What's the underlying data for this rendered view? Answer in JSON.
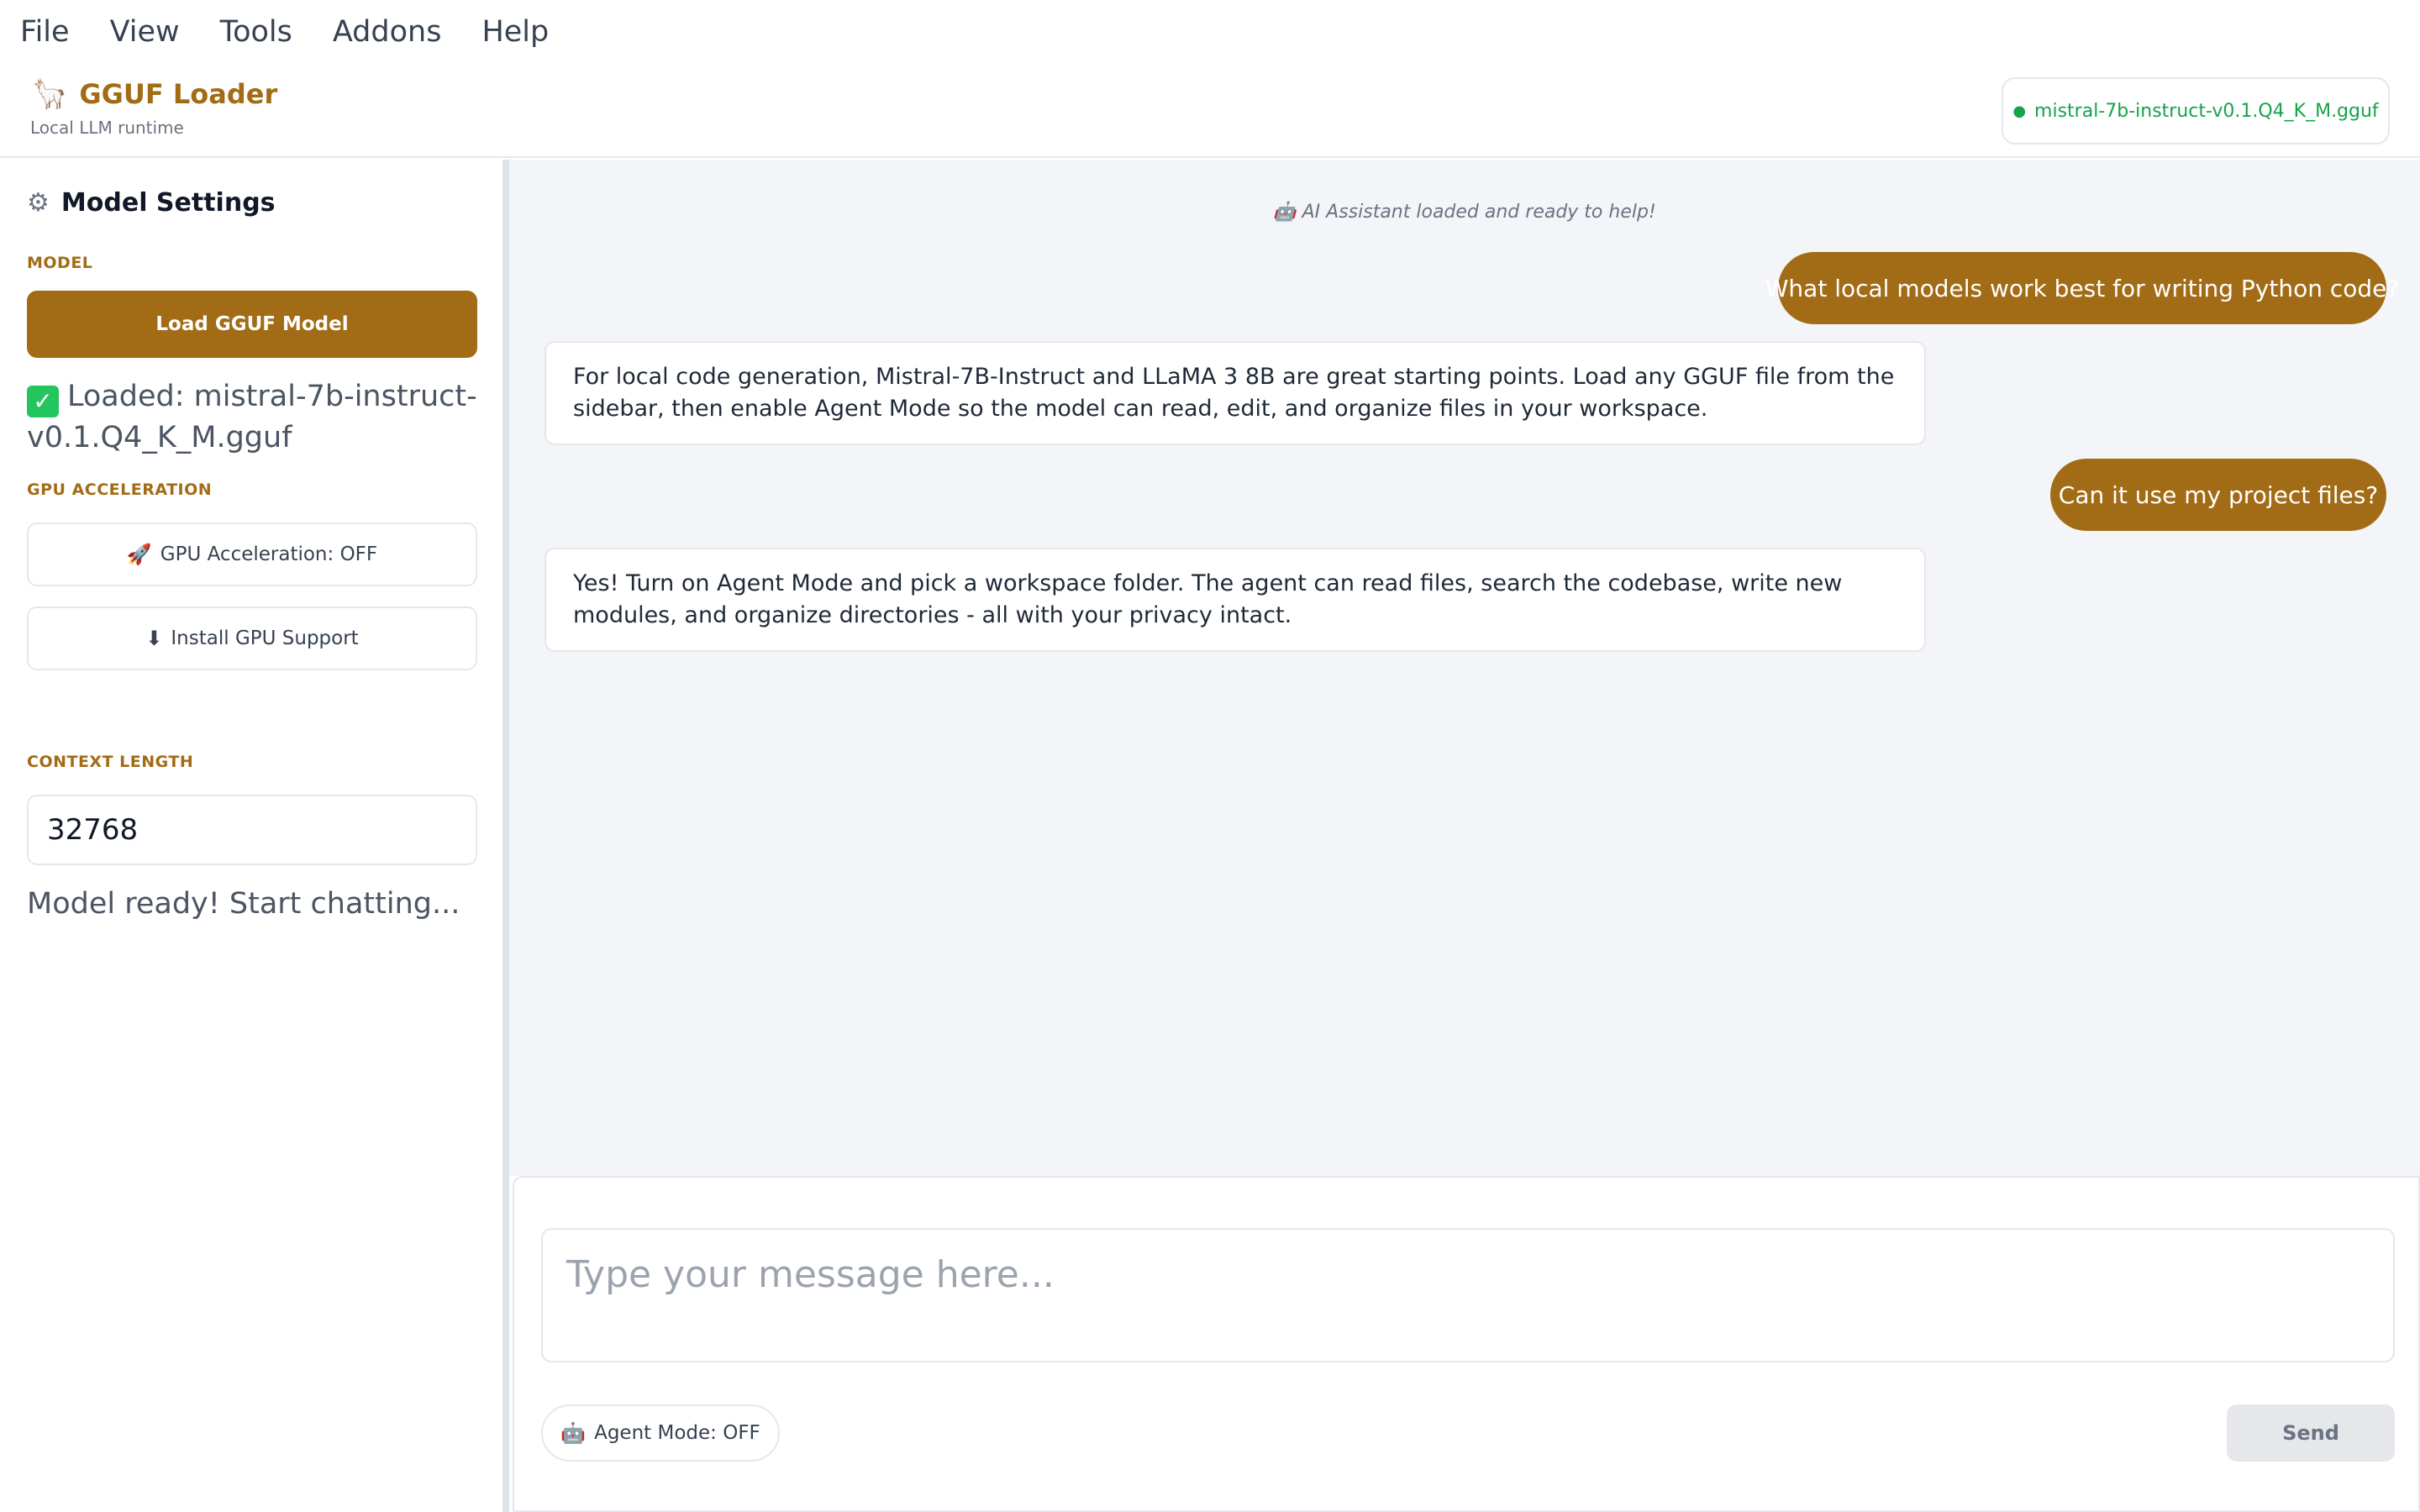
{
  "menubar": {
    "items": [
      "File",
      "View",
      "Tools",
      "Addons",
      "Help"
    ]
  },
  "header": {
    "app_icon": "llama-icon",
    "title": "GGUF Loader",
    "subtitle": "Local LLM runtime",
    "model_status": "mistral-7b-instruct-v0.1.Q4_K_M.gguf",
    "model_status_color": "#16a34a"
  },
  "sidebar": {
    "title": "Model Settings",
    "title_icon": "gear-icon",
    "model_section": "MODEL",
    "load_button": "Load GGUF Model",
    "loaded_text": "Loaded: mistral-7b-instruct-v0.1.Q4_K_M.gguf",
    "gpu_section": "GPU ACCELERATION",
    "gpu_toggle_icon": "rocket-icon",
    "gpu_toggle": "GPU Acceleration: OFF",
    "install_gpu_icon": "download-arrow-icon",
    "install_gpu": "Install GPU Support",
    "context_section": "CONTEXT LENGTH",
    "context_value": "32768",
    "status": "Model ready! Start chatting..."
  },
  "chat": {
    "system_message": "AI Assistant loaded and ready to help!",
    "system_icon": "robot-icon",
    "messages": [
      {
        "role": "user",
        "text": "What local models work best for writing Python code?"
      },
      {
        "role": "assistant",
        "text": "For local code generation, Mistral-7B-Instruct and LLaMA 3 8B are great starting points. Load any GGUF file from the sidebar, then enable Agent Mode so the model can read, edit, and organize files in your workspace."
      },
      {
        "role": "user",
        "text": "Can it use my project files?"
      },
      {
        "role": "assistant",
        "text": "Yes! Turn on Agent Mode and pick a workspace folder. The agent can read files, search the codebase, write new modules, and organize directories - all with your privacy intact."
      }
    ]
  },
  "composer": {
    "placeholder": "Type your message here...",
    "agent_mode_icon": "robot-icon",
    "agent_mode": "Agent Mode: OFF",
    "send": "Send"
  },
  "colors": {
    "accent": "#a26c16",
    "chat_background": "#f3f5f8",
    "status_green": "#16a34a"
  }
}
